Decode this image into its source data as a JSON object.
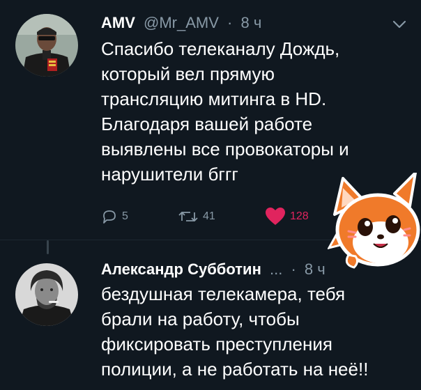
{
  "tweets": [
    {
      "author": "AMV",
      "handle": "@Mr_AMV",
      "separator": "·",
      "time": "8 ч",
      "text_lines": [
        "Спасибо телеканалу Дождь,",
        "который вел прямую",
        "трансляцию митинга в HD.",
        "Благодаря вашей работе",
        "выявлены все провокаторы и",
        "нарушители бггг"
      ],
      "actions": {
        "replies": "5",
        "retweets": "41",
        "likes": "128"
      },
      "menu_icon": "chevron-down-icon"
    },
    {
      "author": "Александр Субботин",
      "ellipsis": "...",
      "separator": "·",
      "time": "8 ч",
      "text_lines": [
        "бездушная телекамера, тебя",
        "брали на работу, чтобы",
        "фиксировать преступления",
        "полиции, а не работать на неё!!"
      ]
    }
  ],
  "colors": {
    "background": "#101820",
    "text_primary": "#ffffff",
    "text_secondary": "#8899a6",
    "like": "#e0245e",
    "sticker_orange": "#f07a2a"
  },
  "icons": {
    "reply": "reply-icon",
    "retweet": "retweet-icon",
    "like": "heart-icon",
    "share": "share-icon",
    "sticker": "fox-sticker"
  }
}
